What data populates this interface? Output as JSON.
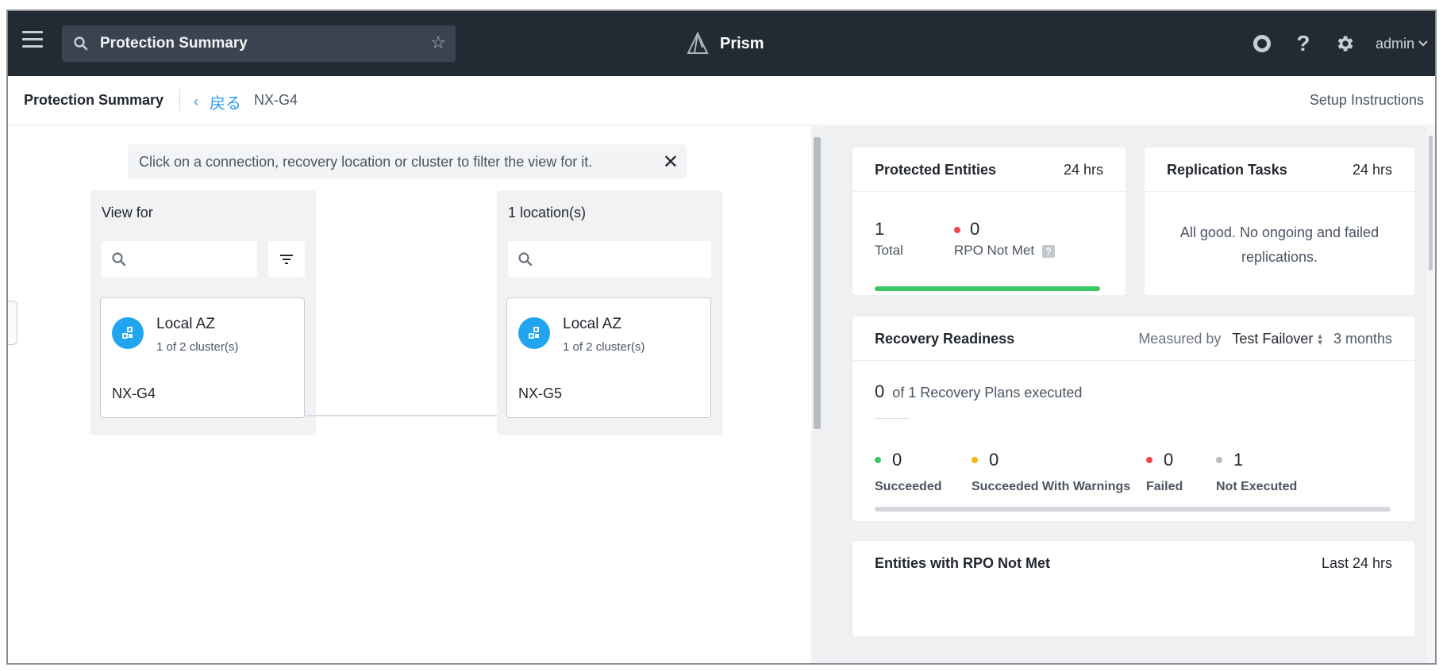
{
  "topbar": {
    "search_text": "Protection Summary",
    "brand": "Prism",
    "user": "admin"
  },
  "breadcrumb": {
    "title": "Protection Summary",
    "back_label": "戻る",
    "current": "NX-G4",
    "setup_instructions": "Setup Instructions"
  },
  "topology": {
    "hint": "Click on a connection, recovery location or cluster to filter the view for it.",
    "left_column": {
      "title": "View for",
      "card": {
        "name": "Local AZ",
        "subtitle": "1 of 2 cluster(s)",
        "cluster": "NX-G4"
      }
    },
    "right_column": {
      "title": "1 location(s)",
      "card": {
        "name": "Local AZ",
        "subtitle": "1 of 2 cluster(s)",
        "cluster": "NX-G5"
      }
    }
  },
  "protected_entities": {
    "title": "Protected Entities",
    "period": "24 hrs",
    "total_value": "1",
    "total_label": "Total",
    "rpo_value": "0",
    "rpo_label": "RPO Not Met",
    "progress_fraction": 1.0
  },
  "replication_tasks": {
    "title": "Replication Tasks",
    "period": "24 hrs",
    "message": "All good. No ongoing and failed replications."
  },
  "recovery_readiness": {
    "title": "Recovery Readiness",
    "measured_by_label": "Measured by",
    "measured_by_value": "Test Failover",
    "period": "3 months",
    "executed_count": "0",
    "executed_text": "of 1 Recovery Plans executed",
    "stats": [
      {
        "value": "0",
        "label": "Succeeded",
        "color": "#3ac663"
      },
      {
        "value": "0",
        "label": "Succeeded With Warnings",
        "color": "#f5b619"
      },
      {
        "value": "0",
        "label": "Failed",
        "color": "#ef4848"
      },
      {
        "value": "1",
        "label": "Not Executed",
        "color": "#b8bdc4"
      }
    ]
  },
  "entities_rpo": {
    "title": "Entities with RPO Not Met",
    "period": "Last 24 hrs"
  },
  "colors": {
    "accent": "#2f9cee",
    "topbar": "#222a34",
    "avatar": "#22a5f1",
    "rpo_dot": "#ef4848"
  }
}
